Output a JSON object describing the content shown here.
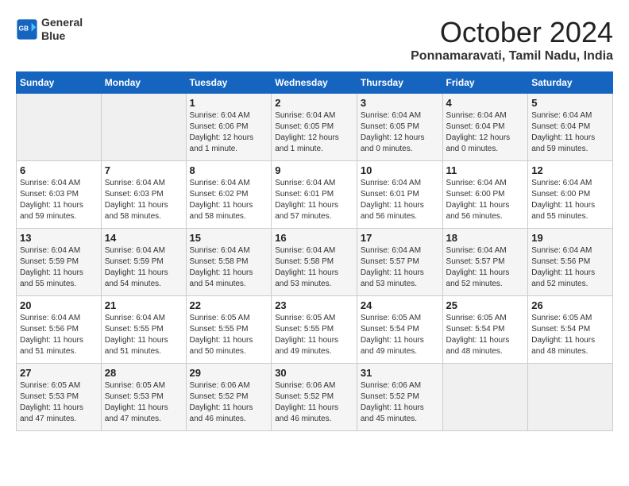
{
  "header": {
    "logo_line1": "General",
    "logo_line2": "Blue",
    "month": "October 2024",
    "location": "Ponnamaravati, Tamil Nadu, India"
  },
  "weekdays": [
    "Sunday",
    "Monday",
    "Tuesday",
    "Wednesday",
    "Thursday",
    "Friday",
    "Saturday"
  ],
  "weeks": [
    [
      {
        "day": "",
        "info": ""
      },
      {
        "day": "",
        "info": ""
      },
      {
        "day": "1",
        "info": "Sunrise: 6:04 AM\nSunset: 6:06 PM\nDaylight: 12 hours\nand 1 minute."
      },
      {
        "day": "2",
        "info": "Sunrise: 6:04 AM\nSunset: 6:05 PM\nDaylight: 12 hours\nand 1 minute."
      },
      {
        "day": "3",
        "info": "Sunrise: 6:04 AM\nSunset: 6:05 PM\nDaylight: 12 hours\nand 0 minutes."
      },
      {
        "day": "4",
        "info": "Sunrise: 6:04 AM\nSunset: 6:04 PM\nDaylight: 12 hours\nand 0 minutes."
      },
      {
        "day": "5",
        "info": "Sunrise: 6:04 AM\nSunset: 6:04 PM\nDaylight: 11 hours\nand 59 minutes."
      }
    ],
    [
      {
        "day": "6",
        "info": "Sunrise: 6:04 AM\nSunset: 6:03 PM\nDaylight: 11 hours\nand 59 minutes."
      },
      {
        "day": "7",
        "info": "Sunrise: 6:04 AM\nSunset: 6:03 PM\nDaylight: 11 hours\nand 58 minutes."
      },
      {
        "day": "8",
        "info": "Sunrise: 6:04 AM\nSunset: 6:02 PM\nDaylight: 11 hours\nand 58 minutes."
      },
      {
        "day": "9",
        "info": "Sunrise: 6:04 AM\nSunset: 6:01 PM\nDaylight: 11 hours\nand 57 minutes."
      },
      {
        "day": "10",
        "info": "Sunrise: 6:04 AM\nSunset: 6:01 PM\nDaylight: 11 hours\nand 56 minutes."
      },
      {
        "day": "11",
        "info": "Sunrise: 6:04 AM\nSunset: 6:00 PM\nDaylight: 11 hours\nand 56 minutes."
      },
      {
        "day": "12",
        "info": "Sunrise: 6:04 AM\nSunset: 6:00 PM\nDaylight: 11 hours\nand 55 minutes."
      }
    ],
    [
      {
        "day": "13",
        "info": "Sunrise: 6:04 AM\nSunset: 5:59 PM\nDaylight: 11 hours\nand 55 minutes."
      },
      {
        "day": "14",
        "info": "Sunrise: 6:04 AM\nSunset: 5:59 PM\nDaylight: 11 hours\nand 54 minutes."
      },
      {
        "day": "15",
        "info": "Sunrise: 6:04 AM\nSunset: 5:58 PM\nDaylight: 11 hours\nand 54 minutes."
      },
      {
        "day": "16",
        "info": "Sunrise: 6:04 AM\nSunset: 5:58 PM\nDaylight: 11 hours\nand 53 minutes."
      },
      {
        "day": "17",
        "info": "Sunrise: 6:04 AM\nSunset: 5:57 PM\nDaylight: 11 hours\nand 53 minutes."
      },
      {
        "day": "18",
        "info": "Sunrise: 6:04 AM\nSunset: 5:57 PM\nDaylight: 11 hours\nand 52 minutes."
      },
      {
        "day": "19",
        "info": "Sunrise: 6:04 AM\nSunset: 5:56 PM\nDaylight: 11 hours\nand 52 minutes."
      }
    ],
    [
      {
        "day": "20",
        "info": "Sunrise: 6:04 AM\nSunset: 5:56 PM\nDaylight: 11 hours\nand 51 minutes."
      },
      {
        "day": "21",
        "info": "Sunrise: 6:04 AM\nSunset: 5:55 PM\nDaylight: 11 hours\nand 51 minutes."
      },
      {
        "day": "22",
        "info": "Sunrise: 6:05 AM\nSunset: 5:55 PM\nDaylight: 11 hours\nand 50 minutes."
      },
      {
        "day": "23",
        "info": "Sunrise: 6:05 AM\nSunset: 5:55 PM\nDaylight: 11 hours\nand 49 minutes."
      },
      {
        "day": "24",
        "info": "Sunrise: 6:05 AM\nSunset: 5:54 PM\nDaylight: 11 hours\nand 49 minutes."
      },
      {
        "day": "25",
        "info": "Sunrise: 6:05 AM\nSunset: 5:54 PM\nDaylight: 11 hours\nand 48 minutes."
      },
      {
        "day": "26",
        "info": "Sunrise: 6:05 AM\nSunset: 5:54 PM\nDaylight: 11 hours\nand 48 minutes."
      }
    ],
    [
      {
        "day": "27",
        "info": "Sunrise: 6:05 AM\nSunset: 5:53 PM\nDaylight: 11 hours\nand 47 minutes."
      },
      {
        "day": "28",
        "info": "Sunrise: 6:05 AM\nSunset: 5:53 PM\nDaylight: 11 hours\nand 47 minutes."
      },
      {
        "day": "29",
        "info": "Sunrise: 6:06 AM\nSunset: 5:52 PM\nDaylight: 11 hours\nand 46 minutes."
      },
      {
        "day": "30",
        "info": "Sunrise: 6:06 AM\nSunset: 5:52 PM\nDaylight: 11 hours\nand 46 minutes."
      },
      {
        "day": "31",
        "info": "Sunrise: 6:06 AM\nSunset: 5:52 PM\nDaylight: 11 hours\nand 45 minutes."
      },
      {
        "day": "",
        "info": ""
      },
      {
        "day": "",
        "info": ""
      }
    ]
  ]
}
